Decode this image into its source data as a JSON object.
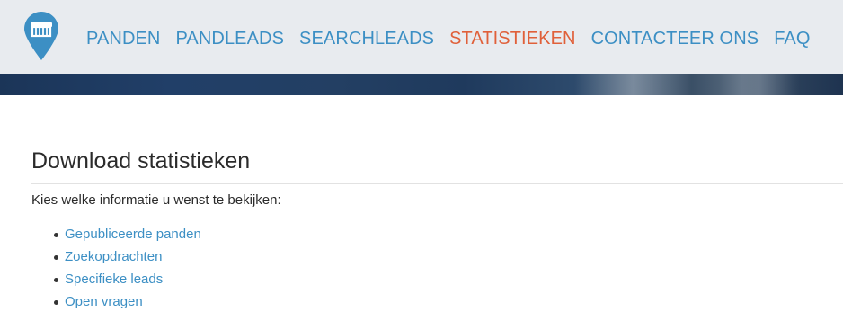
{
  "nav": {
    "logo_icon": "shop-pin-icon",
    "items": [
      {
        "label": "PANDEN",
        "active": false
      },
      {
        "label": "PANDLEADS",
        "active": false
      },
      {
        "label": "SEARCHLEADS",
        "active": false
      },
      {
        "label": "STATISTIEKEN",
        "active": true
      },
      {
        "label": "CONTACTEER ONS",
        "active": false
      },
      {
        "label": "FAQ",
        "active": false
      }
    ]
  },
  "colors": {
    "link": "#3c8fc4",
    "active": "#e0603a",
    "nav_bg": "#e8ebef",
    "banner": "#1f3a5d"
  },
  "main": {
    "title": "Download statistieken",
    "intro": "Kies welke informatie u wenst te bekijken:",
    "options": [
      {
        "label": "Gepubliceerde panden"
      },
      {
        "label": "Zoekopdrachten"
      },
      {
        "label": "Specifieke leads"
      },
      {
        "label": "Open vragen"
      }
    ]
  }
}
